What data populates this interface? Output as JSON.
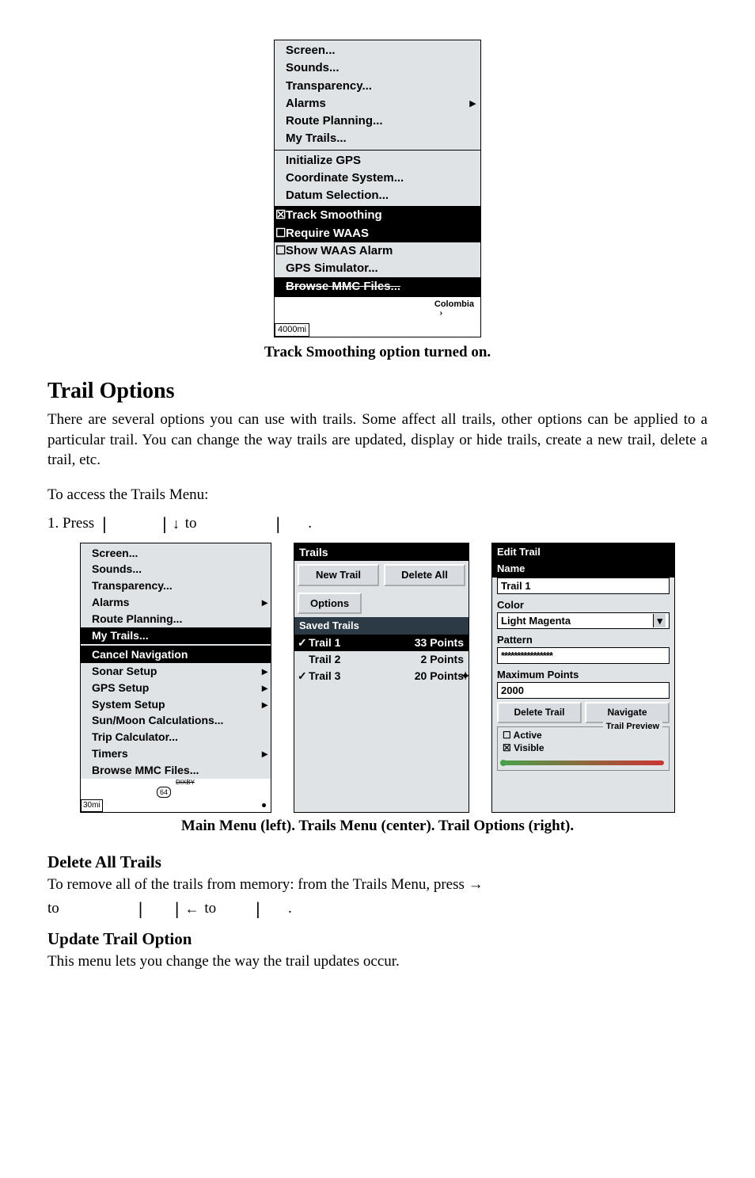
{
  "figure1": {
    "menu_group1": [
      "Screen...",
      "Sounds...",
      "Transparency...",
      "Alarms",
      "Route Planning...",
      "My Trails..."
    ],
    "menu_group1_arrow_index": 3,
    "menu_group2": [
      "Initialize GPS",
      "Coordinate System...",
      "Datum Selection..."
    ],
    "track_smoothing": "Track Smoothing",
    "require_waas": "Require WAAS",
    "show_waas_alarm": "Show WAAS Alarm",
    "gps_simulator": "GPS Simulator...",
    "browse_mmc": "Browse MMC Files...",
    "map_label": "Colombia",
    "map_quote": "›",
    "scale": "4000mi"
  },
  "caption1": "Track Smoothing option turned on.",
  "section_title": "Trail Options",
  "section_body": "There are several options you can use with trails. Some affect all trails, other options can be applied to a particular trail. You can change the way trails are updated, display or hide trails, create a new trail, delete a trail, etc.",
  "access_line": "To access the Trails Menu:",
  "step1_prefix": "1. Press ",
  "step1_mid": " to ",
  "panel_left": {
    "group1": [
      "Screen...",
      "Sounds...",
      "Transparency...",
      "Alarms",
      "Route Planning...",
      "My Trails..."
    ],
    "group1_arrow_index": 3,
    "group1_selected_index": 5,
    "group2": [
      "Cancel Navigation",
      "Sonar Setup",
      "GPS Setup",
      "System Setup",
      "Sun/Moon Calculations...",
      "Trip Calculator...",
      "Timers",
      "Browse MMC Files..."
    ],
    "group2_arrow_indices": [
      1,
      2,
      3,
      6
    ],
    "group2_selected_index": 0,
    "map_label": "DIXBY",
    "map_road": "64",
    "scale": "30mi"
  },
  "panel_center": {
    "title": "Trails",
    "btn_new": "New Trail",
    "btn_delete_all": "Delete All",
    "btn_options": "Options",
    "saved_header": "Saved Trails",
    "rows": [
      {
        "checked": true,
        "name": "Trail 1",
        "points": "33 Points",
        "selected": true
      },
      {
        "checked": false,
        "name": "Trail 2",
        "points": "2 Points"
      },
      {
        "checked": true,
        "name": "Trail 3",
        "points": "20 Points",
        "cursor": true
      }
    ]
  },
  "panel_right": {
    "title": "Edit Trail",
    "name_label": "Name",
    "name_value": "Trail 1",
    "color_label": "Color",
    "color_value": "Light Magenta",
    "pattern_label": "Pattern",
    "pattern_value": "****************",
    "max_points_label": "Maximum Points",
    "max_points_value": "2000",
    "btn_delete": "Delete Trail",
    "btn_navigate": "Navigate",
    "preview_title": "Trail Preview",
    "chk_active": "Active",
    "chk_visible": "Visible"
  },
  "caption2": "Main Menu (left). Trails Menu (center). Trail Options (right).",
  "sub1_title": "Delete All Trails",
  "sub1_line1": "To remove all of the trails from memory: from the Trails Menu, press →",
  "sub1_line2_a": "to ",
  "sub1_line2_b": " to ",
  "sub2_title": "Update Trail Option",
  "sub2_body": "This menu lets you change the way the trail updates occur."
}
